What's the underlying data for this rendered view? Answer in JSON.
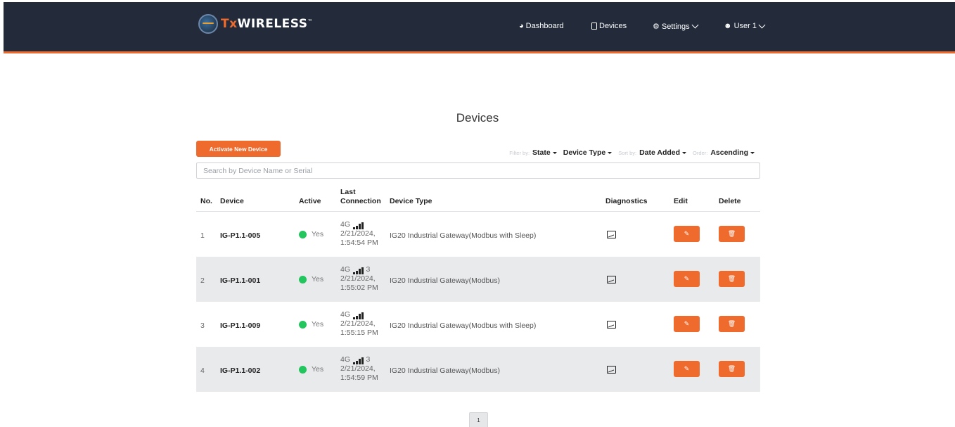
{
  "brand": {
    "prefix": "Tx",
    "name": "WIRELESS",
    "tm": "™"
  },
  "nav": {
    "dashboard": {
      "icon": "dashboard-icon",
      "label": "Dashboard"
    },
    "devices": {
      "icon": "device-icon",
      "label": "Devices"
    },
    "settings": {
      "icon": "gears-icon",
      "label": "Settings"
    },
    "user": {
      "icon": "user-icon",
      "label": "User 1"
    }
  },
  "page": {
    "title": "Devices"
  },
  "toolbar": {
    "activate_label": "Activate New Device",
    "filter_by": "Filter by:",
    "state": "State",
    "device_type": "Device Type",
    "sort_by": "Sort by:",
    "date_added": "Date Added",
    "order": "Order:",
    "ascending": "Ascending"
  },
  "search": {
    "placeholder": "Search by Device Name or Serial",
    "value": ""
  },
  "table": {
    "headers": {
      "no": "No.",
      "device": "Device",
      "active": "Active",
      "last_connection_1": "Last",
      "last_connection_2": "Connection",
      "device_type": "Device Type",
      "diagnostics": "Diagnostics",
      "edit": "Edit",
      "delete": "Delete"
    },
    "rows": [
      {
        "no": "1",
        "device": "IG-P1.1-005",
        "active": "Yes",
        "network": "4G",
        "signal_level": 4,
        "signal_extra": "",
        "date": "2/21/2024,",
        "time": "1:54:54 PM",
        "type": "IG20 Industrial Gateway(Modbus with Sleep)"
      },
      {
        "no": "2",
        "device": "IG-P1.1-001",
        "active": "Yes",
        "network": "4G",
        "signal_level": 4,
        "signal_extra": "3",
        "date": "2/21/2024,",
        "time": "1:55:02 PM",
        "type": "IG20 Industrial Gateway(Modbus)"
      },
      {
        "no": "3",
        "device": "IG-P1.1-009",
        "active": "Yes",
        "network": "4G",
        "signal_level": 4,
        "signal_extra": "",
        "date": "2/21/2024,",
        "time": "1:55:15 PM",
        "type": "IG20 Industrial Gateway(Modbus with Sleep)"
      },
      {
        "no": "4",
        "device": "IG-P1.1-002",
        "active": "Yes",
        "network": "4G",
        "signal_level": 4,
        "signal_extra": "3",
        "date": "2/21/2024,",
        "time": "1:54:59 PM",
        "type": "IG20 Industrial Gateway(Modbus)"
      }
    ]
  },
  "pagination": {
    "current": "1"
  },
  "colors": {
    "accent": "#ee6a2d",
    "header_bg": "#232b3b",
    "active_dot": "#22c55e"
  }
}
